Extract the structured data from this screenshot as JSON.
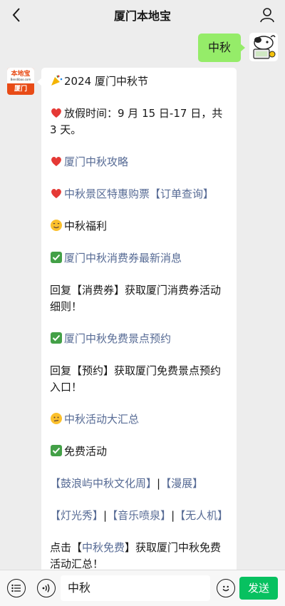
{
  "nav": {
    "title": "厦门本地宝"
  },
  "messages": {
    "user_text": "中秋",
    "bot_brand": "本地宝",
    "bot_url": "Bendibao.com",
    "bot_city": "厦门",
    "reply": {
      "l1": "2024 厦门中秋节",
      "l2": "放假时间：9 月 15 日-17 日，共 3 天。",
      "l3": "厦门中秋攻略",
      "l4": "中秋景区特惠购票【订单查询】",
      "l5": "中秋福利",
      "l6": "厦门中秋消费券最新消息",
      "l7": "回复【消费券】获取厦门消费券活动细则！",
      "l8": "厦门中秋免费景点预约",
      "l9": "回复【预约】获取厦门免费景点预约入口！",
      "l10": "中秋活动大汇总",
      "l11": "免费活动",
      "l12a": "【鼓浪屿中秋文化周】",
      "l12sep": "|",
      "l12b": "【漫展】",
      "l13a": "【灯光秀】",
      "l13sep1": "|",
      "l13b": "【音乐喷泉】",
      "l13sep2": "|",
      "l13c": "【无人机】",
      "l14a": "点击【",
      "l14link": "中秋免费",
      "l14b": "】获取厦门中秋免费活动汇总！"
    }
  },
  "composer": {
    "input_value": "中秋",
    "send_label": "发送"
  },
  "colors": {
    "accent": "#07c160",
    "bubble_user": "#95ec69",
    "link": "#576b95",
    "brand": "#e84b16"
  }
}
